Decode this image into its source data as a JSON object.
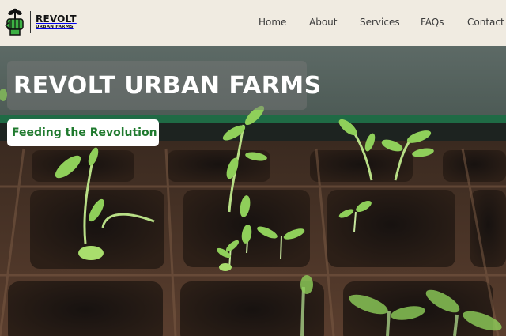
{
  "header": {
    "logo": {
      "main": "REVOLT",
      "sub": "URBAN FARMS",
      "icon": "fist-sprout-icon"
    },
    "nav": [
      {
        "label": "Home"
      },
      {
        "label": "About"
      },
      {
        "label": "Services"
      },
      {
        "label": "FAQs"
      },
      {
        "label": "Contact"
      }
    ]
  },
  "hero": {
    "title": "REVOLT URBAN FARMS",
    "tagline": "Feeding the Revolution",
    "image": "seedlings-in-peat-tray"
  },
  "colors": {
    "header_bg": "#f0ebe1",
    "tagline_text": "#1f7a2e",
    "logo_green": "#3cb043"
  }
}
